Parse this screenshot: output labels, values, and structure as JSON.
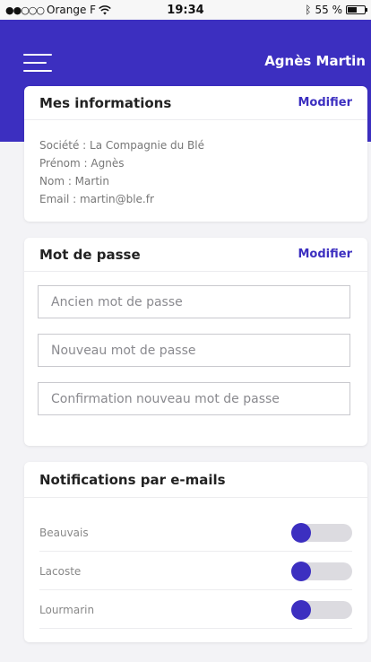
{
  "status_bar": {
    "signal": "●●○○○",
    "carrier": "Orange F",
    "time": "19:34",
    "battery_text": "55 %",
    "battery_level": 0.55
  },
  "header": {
    "user_name": "Agnès Martin"
  },
  "info_card": {
    "title": "Mes informations",
    "action": "Modifier",
    "lines": [
      "Société : La Compagnie du Blé",
      "Prénom : Agnès",
      "Nom : Martin",
      "Email : martin@ble.fr"
    ]
  },
  "password_card": {
    "title": "Mot de passe",
    "action": "Modifier",
    "fields": [
      {
        "placeholder": "Ancien mot de passe",
        "value": ""
      },
      {
        "placeholder": "Nouveau mot de passe",
        "value": ""
      },
      {
        "placeholder": "Confirmation nouveau mot de passe",
        "value": ""
      }
    ]
  },
  "notifications_card": {
    "title": "Notifications par e-mails",
    "items": [
      {
        "label": "Beauvais",
        "enabled": false
      },
      {
        "label": "Lacoste",
        "enabled": false
      },
      {
        "label": "Lourmarin",
        "enabled": false
      }
    ]
  },
  "colors": {
    "accent": "#3c2fc0",
    "background": "#f3f3f6",
    "toggle_track": "#dcdbe0"
  }
}
